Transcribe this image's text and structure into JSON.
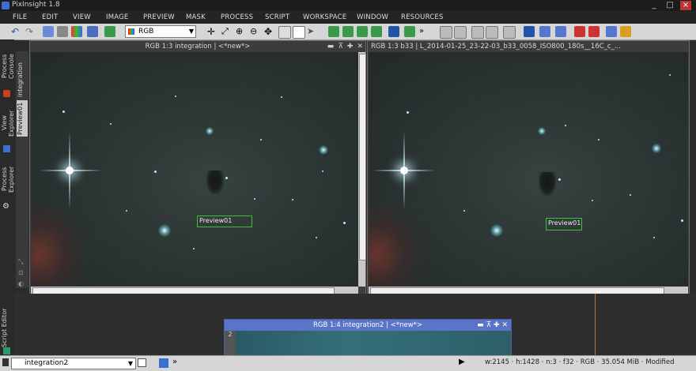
{
  "app": {
    "title": "PixInsight 1.8"
  },
  "menu": [
    "FILE",
    "EDIT",
    "VIEW",
    "IMAGE",
    "PREVIEW",
    "MASK",
    "PROCESS",
    "SCRIPT",
    "WORKSPACE",
    "WINDOW",
    "RESOURCES"
  ],
  "toolbar": {
    "color_space": "RGB"
  },
  "sidebar": {
    "process_console": "Process Console",
    "view_explorer": "View Explorer",
    "process_explorer": "Process Explorer",
    "script_editor": "Script Editor"
  },
  "view_tabs": {
    "integration": "integration",
    "preview01": "Preview01"
  },
  "left_window": {
    "title": "RGB 1:3 integration | <*new*>",
    "preview_label": "Preview01"
  },
  "right_window": {
    "title": "RGB 1:3 b33 | L_2014-01-25_23-22-03_b33_0058_ISO800_180s__16C_c_...",
    "preview_label": "Preview01"
  },
  "mini_window": {
    "title": "RGB 1:4 integration2 | <*new*>",
    "side_label": "2"
  },
  "statusbar": {
    "view_name": "integration2",
    "info": "w:2145 · h:1428 · n:3 · f32 · RGB · 35.054 MiB · Modified"
  },
  "colors": {
    "accent": "#5a74c8",
    "preview_border": "#3cc03c"
  }
}
